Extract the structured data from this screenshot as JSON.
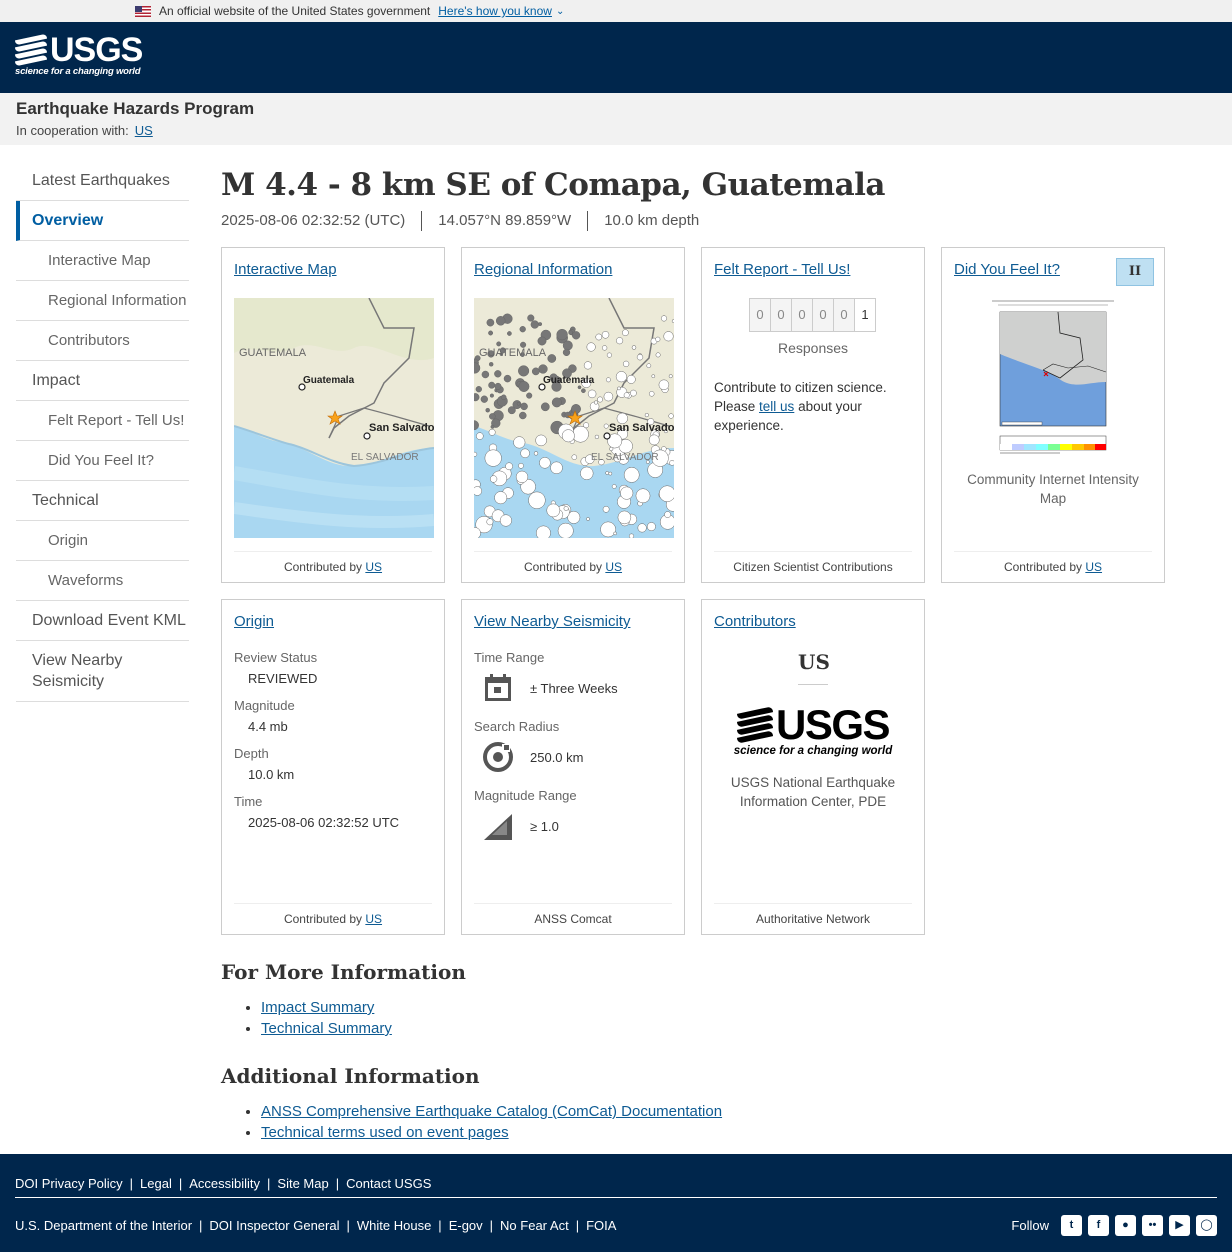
{
  "gov_banner": {
    "text": "An official website of the United States government",
    "link": "Here's how you know"
  },
  "header": {
    "logo_word": "USGS",
    "logo_tagline": "science for a changing world",
    "program": "Earthquake Hazards Program",
    "coop_label": "In cooperation with:",
    "coop_link": "US"
  },
  "sidebar": {
    "items": [
      {
        "label": "Latest Earthquakes"
      },
      {
        "label": "Overview"
      },
      {
        "label": "Interactive Map"
      },
      {
        "label": "Regional Information"
      },
      {
        "label": "Contributors"
      },
      {
        "label": "Impact"
      },
      {
        "label": "Felt Report - Tell Us!"
      },
      {
        "label": "Did You Feel It?"
      },
      {
        "label": "Technical"
      },
      {
        "label": "Origin"
      },
      {
        "label": "Waveforms"
      },
      {
        "label": "Download Event KML"
      },
      {
        "label": "View Nearby Seismicity"
      }
    ]
  },
  "event": {
    "title": "M 4.4 - 8 km SE of Comapa, Guatemala",
    "time": "2025-08-06 02:32:52 (UTC)",
    "location": "14.057°N 89.859°W",
    "depth": "10.0 km depth"
  },
  "cards": {
    "interactive_map": {
      "title": "Interactive Map",
      "footer_prefix": "Contributed by",
      "footer_link": "US",
      "labels": {
        "country1": "GUATEMALA",
        "city1": "Guatemala",
        "city2": "San Salvador",
        "country2": "EL SALVADOR"
      }
    },
    "regional": {
      "title": "Regional Information",
      "footer_prefix": "Contributed by",
      "footer_link": "US",
      "labels": {
        "country1": "GUATEMALA",
        "city1": "Guatemala",
        "city2": "San Salvador",
        "country2": "EL SALVADOR"
      }
    },
    "felt": {
      "title": "Felt Report - Tell Us!",
      "digits": [
        "0",
        "0",
        "0",
        "0",
        "0",
        "1"
      ],
      "responses_label": "Responses",
      "text_before": "Contribute to citizen science. Please ",
      "text_link": "tell us",
      "text_after": " about your experience.",
      "footer": "Citizen Scientist Contributions"
    },
    "dyfi": {
      "title": "Did You Feel It?",
      "badge": "II",
      "caption": "Community Internet Intensity Map",
      "footer_prefix": "Contributed by",
      "footer_link": "US"
    },
    "origin": {
      "title": "Origin",
      "fields": [
        {
          "label": "Review Status",
          "value": "REVIEWED"
        },
        {
          "label": "Magnitude",
          "value": "4.4 mb"
        },
        {
          "label": "Depth",
          "value": "10.0 km"
        },
        {
          "label": "Time",
          "value": "2025-08-06 02:32:52 UTC"
        }
      ],
      "footer_prefix": "Contributed by",
      "footer_link": "US"
    },
    "seismicity": {
      "title": "View Nearby Seismicity",
      "time_range_label": "Time Range",
      "time_range_value": "± Three Weeks",
      "radius_label": "Search Radius",
      "radius_value": "250.0 km",
      "mag_label": "Magnitude Range",
      "mag_value": "≥ 1.0",
      "footer": "ANSS Comcat"
    },
    "contributors": {
      "title": "Contributors",
      "code": "US",
      "logo_word": "USGS",
      "logo_tagline": "science for a changing world",
      "name": "USGS National Earthquake Information Center, PDE",
      "footer": "Authoritative Network"
    }
  },
  "more_info": {
    "heading": "For More Information",
    "links": [
      "Impact Summary",
      "Technical Summary"
    ]
  },
  "additional_info": {
    "heading": "Additional Information",
    "links": [
      "ANSS Comprehensive Earthquake Catalog (ComCat) Documentation",
      "Technical terms used on event pages"
    ]
  },
  "footer": {
    "row1": [
      "DOI Privacy Policy",
      "Legal",
      "Accessibility",
      "Site Map",
      "Contact USGS"
    ],
    "row2": [
      "U.S. Department of the Interior",
      "DOI Inspector General",
      "White House",
      "E-gov",
      "No Fear Act",
      "FOIA"
    ],
    "follow": "Follow",
    "social_icons": [
      "twitter-icon",
      "facebook-icon",
      "github-icon",
      "flickr-icon",
      "youtube-icon",
      "instagram-icon"
    ]
  },
  "colors": {
    "header_bg": "#00264c",
    "link": "#0e5b93",
    "active_nav": "#005ea2"
  }
}
